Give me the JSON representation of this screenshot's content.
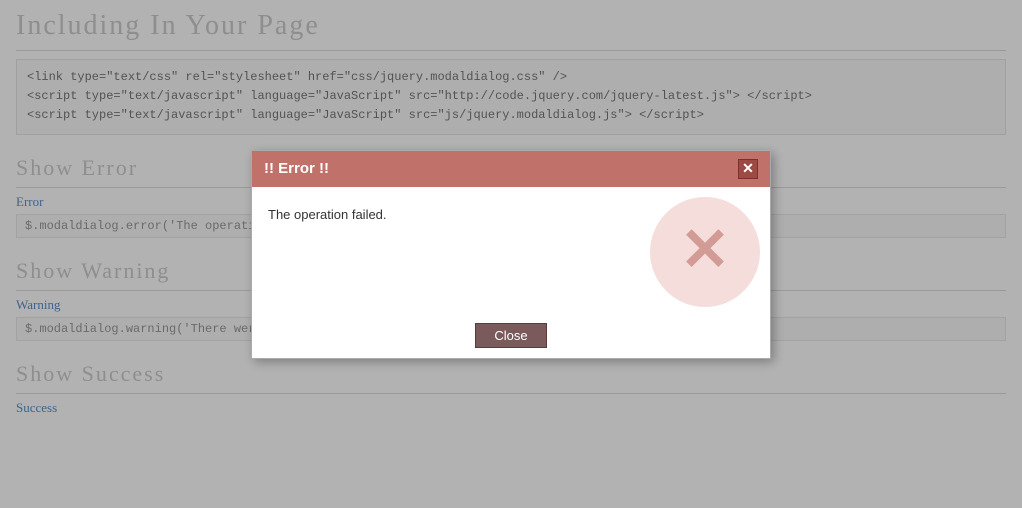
{
  "page": {
    "main_title": "Including In Your Page",
    "code_includes": [
      "<link type=\"text/css\" rel=\"stylesheet\" href=\"css/jquery.modaldialog.css\" />",
      "<script type=\"text/javascript\" language=\"JavaScript\" src=\"http://code.jquery.com/jquery-latest.js\"> <\\/script>",
      "<script type=\"text/javascript\" language=\"JavaScript\" src=\"js/jquery.modaldialog.js\"> <\\/script>"
    ]
  },
  "error_section": {
    "title": "Show Error",
    "link_label": "Error",
    "code": "$.modaldialog.error('The operation failed.');"
  },
  "warning_section": {
    "title": "Show Warning",
    "link_label": "Warning",
    "code": "$.modaldialog.warning('There were problems processing the"
  },
  "success_section": {
    "title": "Show Success",
    "link_label": "Success"
  },
  "modal": {
    "title": "!! Error !!",
    "message": "The operation failed.",
    "close_button_label": "Close",
    "close_x": "✕"
  }
}
